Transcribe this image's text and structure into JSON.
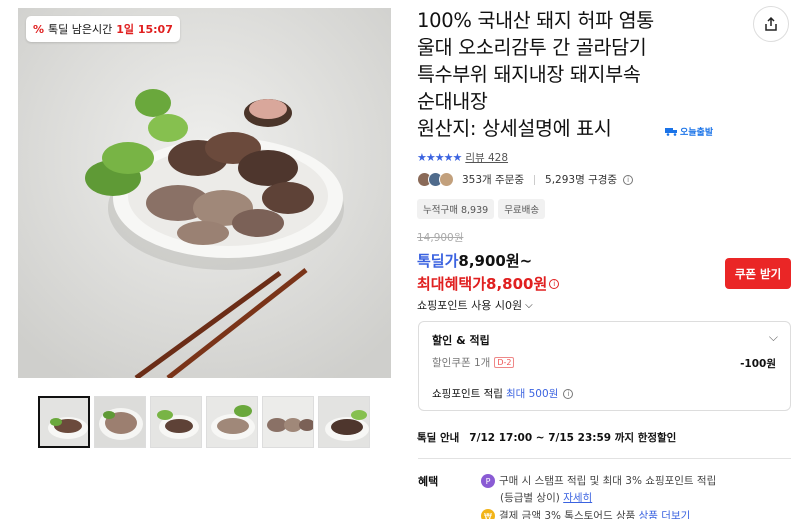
{
  "deal_badge": {
    "label": "톡딜 남은시간",
    "time": "1일 15:07"
  },
  "title": {
    "lines": [
      "100% 국내산 돼지 허파 염통",
      "울대 오소리감투 간 골라담기",
      "특수부위 돼지내장 돼지부속",
      "순대내장",
      "원산지: 상세설명에 표시"
    ],
    "today_shipping": "오늘출발"
  },
  "review": {
    "stars": "★★★★★",
    "label": "리뷰 428"
  },
  "stats": {
    "orders": "353개 주문중",
    "viewers": "5,293명 구경중"
  },
  "chips": [
    "누적구매 8,939",
    "무료배송"
  ],
  "price": {
    "original": "14,900원",
    "talkdeal_label": "톡딜가",
    "talkdeal_price": "8,900원~",
    "max_label": "최대혜택가",
    "max_price": "8,800원",
    "coupon_button": "쿠폰 받기",
    "point_use": "쇼핑포인트 사용 시0원"
  },
  "discount_box": {
    "title": "할인 & 적립",
    "coupon_label": "할인쿠폰 1개",
    "coupon_dday": "D-2",
    "coupon_amount": "-100원",
    "points_label": "쇼핑포인트 적립",
    "points_max": "최대 500원"
  },
  "deal_notice": {
    "label": "톡딜 안내",
    "period": "7/12 17:00 ~ 7/15 23:59 까지 한정할인"
  },
  "benefits": {
    "label": "혜택",
    "line1": "구매 시 스탬프 적립 및 최대 3% 쇼핑포인트 적립",
    "line2_prefix": "(등급별 상이)",
    "line2_link": "자세히",
    "line3_prefix": "결제 금액 3% 톡스토어드 상품",
    "line3_link": "상품 더보기"
  },
  "colors": {
    "accent_blue": "#3b63e0",
    "accent_red": "#e02020",
    "coupon_red": "#ea2626"
  }
}
